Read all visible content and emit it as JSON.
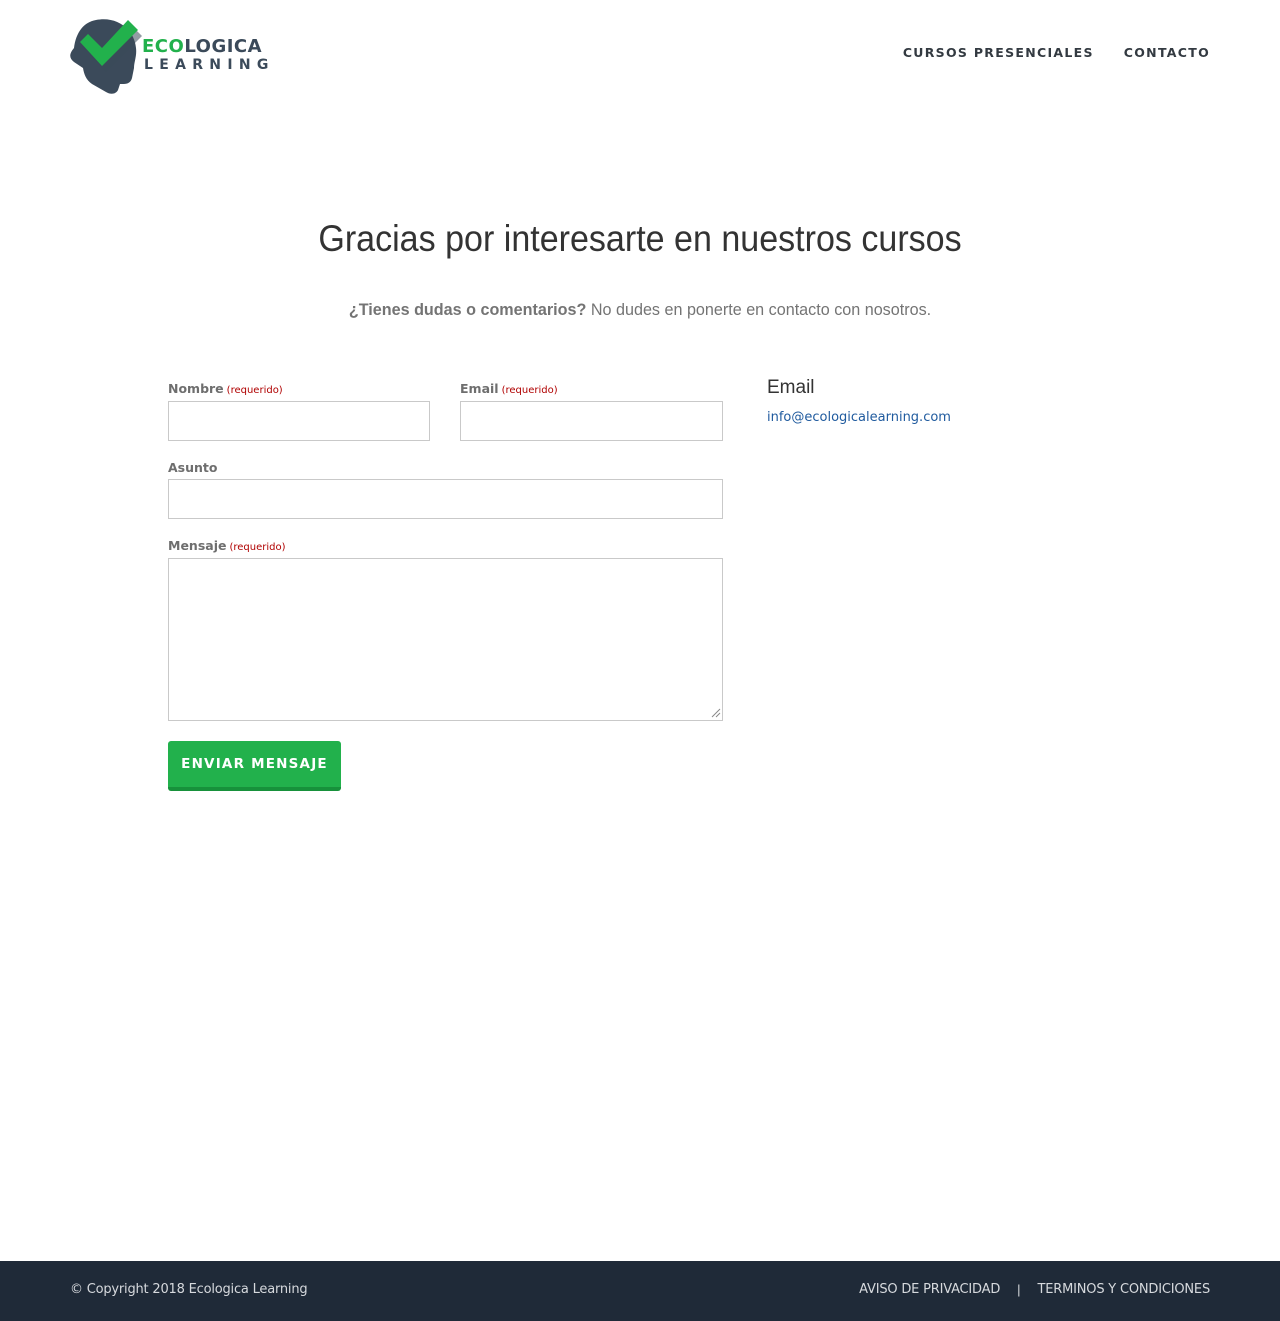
{
  "header": {
    "logo": {
      "word1_green": "ECO",
      "word1_dark": "LOGICA",
      "word2": "LEARNING"
    },
    "nav": [
      "CURSOS PRESENCIALES",
      "CONTACTO"
    ]
  },
  "main": {
    "title": "Gracias por interesarte en nuestros cursos",
    "intro_bold": "¿Tienes dudas o comentarios?",
    "intro_text": "No dudes en ponerte en contacto con nosotros.",
    "form": {
      "name_label": "Nombre",
      "email_label": "Email",
      "subject_label": "Asunto",
      "message_label": "Mensaje",
      "required_text": "(requerido)",
      "submit_label": "ENVIAR MENSAJE"
    },
    "contact": {
      "heading": "Email",
      "email": "info@ecologicalearning.com"
    }
  },
  "footer": {
    "copyright": "© Copyright 2018 Ecologica Learning",
    "links": [
      "AVISO DE PRIVACIDAD",
      "TERMINOS Y CONDICIONES"
    ],
    "separator": "|"
  },
  "colors": {
    "brand_green": "#22b14c",
    "brand_dark": "#3b4a5a",
    "footer_bg": "#1f2a38",
    "link_blue": "#1f5a9e",
    "required_red": "#b00000"
  },
  "icons": {
    "logo": "head-with-checkmark-icon",
    "textarea_resize": "resize-grip-icon"
  }
}
